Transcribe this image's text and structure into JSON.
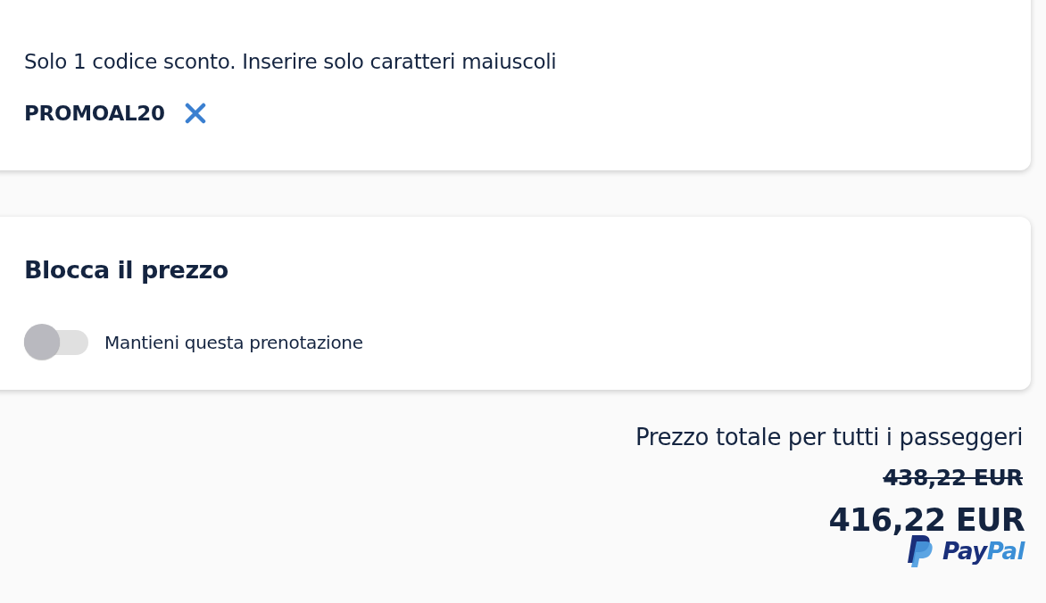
{
  "discount_card": {
    "hint": "Solo 1 codice sconto. Inserire solo caratteri maiuscoli",
    "applied_code": "PROMOAL20"
  },
  "price_lock_card": {
    "title": "Blocca il prezzo",
    "toggle": {
      "label": "Mantieni questa prenotazione",
      "on": false
    }
  },
  "total": {
    "label": "Prezzo totale per tutti i passeggeri",
    "old_price": "438,22 EUR",
    "price": "416,22 EUR",
    "payment_logo": [
      "Pay",
      "Pal"
    ]
  }
}
